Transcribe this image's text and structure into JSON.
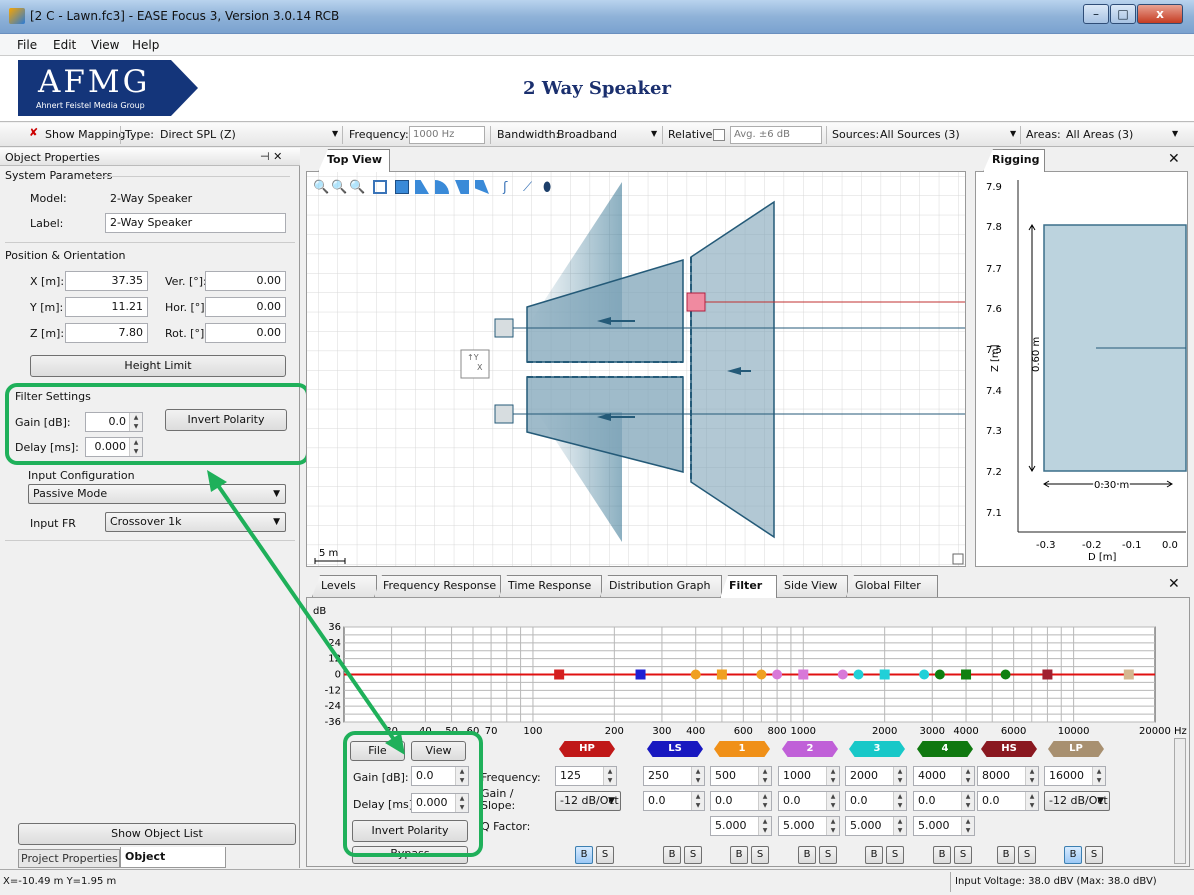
{
  "window": {
    "title": "[2 C - Lawn.fc3] - EASE Focus 3, Version 3.0.14 RCB",
    "min": "–",
    "max": "□",
    "close": "x"
  },
  "menu": [
    "File",
    "Edit",
    "View",
    "Help"
  ],
  "banner": {
    "logo_text": "AFMG",
    "logo_sub": "Ahnert Feistel Media Group",
    "title": "2 Way Speaker"
  },
  "toolbar": {
    "show_mapping": "Show Mapping",
    "type_label": "Type:",
    "type_value": "Direct SPL (Z)",
    "frequency_label": "Frequency:",
    "frequency_value": "1000 Hz",
    "bandwidth_label": "Bandwidth:",
    "bandwidth_value": "Broadband",
    "relative_label": "Relative:",
    "relative_value": "Avg. ±6 dB",
    "sources_label": "Sources:",
    "sources_value": "All Sources (3)",
    "areas_label": "Areas:",
    "areas_value": "All Areas (3)"
  },
  "left": {
    "title": "Object Properties",
    "pin": "⊣ ✕",
    "system_parameters": "System Parameters",
    "model_label": "Model:",
    "model_value": "2-Way Speaker",
    "label_label": "Label:",
    "label_value": "2-Way Speaker",
    "position_orientation": "Position & Orientation",
    "x_label": "X [m]:",
    "x_value": "37.35",
    "y_label": "Y [m]:",
    "y_value": "11.21",
    "z_label": "Z [m]:",
    "z_value": "7.80",
    "ver_label": "Ver. [°]:",
    "ver_value": "0.00",
    "hor_label": "Hor. [°]:",
    "hor_value": "0.00",
    "rot_label": "Rot. [°]:",
    "rot_value": "0.00",
    "height_limit": "Height Limit",
    "filter_settings": "Filter Settings",
    "gain_label": "Gain [dB]:",
    "gain_value": "0.0",
    "delay_label": "Delay [ms]:",
    "delay_value": "0.000",
    "invert_polarity": "Invert Polarity",
    "input_configuration": "Input Configuration",
    "input_mode": "Passive Mode",
    "input_fr_label": "Input FR",
    "input_fr_value": "Crossover 1k",
    "show_object_list": "Show Object List",
    "tab_project": "Project Properties",
    "tab_object": "Object Properties"
  },
  "topview": {
    "tab": "Top View",
    "scale": "5 m"
  },
  "rigging": {
    "tab": "Rigging",
    "close": "✕",
    "y_ticks": [
      "7.9",
      "7.8",
      "7.7",
      "7.6",
      "7.5",
      "7.4",
      "7.3",
      "7.2",
      "7.1"
    ],
    "x_ticks": [
      "-0.3",
      "-0.2",
      "-0.1",
      "0.0"
    ],
    "ylabel": "Z [m]",
    "xlabel": "D [m]",
    "height_dim": "0.60 m",
    "width_dim": "0.30 m"
  },
  "bottom": {
    "tabs": [
      "Levels",
      "Frequency Response",
      "Time Response",
      "Distribution Graph",
      "Filter",
      "Side View",
      "Global Filter"
    ],
    "close": "✕",
    "chart_data": {
      "type": "line",
      "ylabel": "dB",
      "y_ticks": [
        "36",
        "24",
        "12",
        "0",
        "-12",
        "-24",
        "-36"
      ],
      "x_ticks": [
        "30",
        "40",
        "50",
        "60",
        "70",
        "100",
        "200",
        "300",
        "400",
        "600",
        "800",
        "1000",
        "2000",
        "3000",
        "4000",
        "6000",
        "10000",
        "20000 Hz"
      ],
      "ylim": [
        -36,
        36
      ],
      "xlim": [
        20,
        20000
      ],
      "series": [
        {
          "values": [
            0,
            0
          ]
        }
      ],
      "markers": [
        {
          "freq": 125,
          "color": "#d42020",
          "shape": "square"
        },
        {
          "freq": 250,
          "color": "#2020d4",
          "shape": "square"
        },
        {
          "freq": 400,
          "color": "#f0a020",
          "shape": "circle"
        },
        {
          "freq": 500,
          "color": "#f0a020",
          "shape": "square"
        },
        {
          "freq": 700,
          "color": "#f0a020",
          "shape": "circle"
        },
        {
          "freq": 800,
          "color": "#d878d8",
          "shape": "circle"
        },
        {
          "freq": 1000,
          "color": "#d878d8",
          "shape": "square"
        },
        {
          "freq": 1400,
          "color": "#d878d8",
          "shape": "circle"
        },
        {
          "freq": 1600,
          "color": "#20d0d8",
          "shape": "circle"
        },
        {
          "freq": 2000,
          "color": "#20d0d8",
          "shape": "square"
        },
        {
          "freq": 2800,
          "color": "#20d0d8",
          "shape": "circle"
        },
        {
          "freq": 3200,
          "color": "#108010",
          "shape": "circle"
        },
        {
          "freq": 4000,
          "color": "#108010",
          "shape": "square"
        },
        {
          "freq": 5600,
          "color": "#108010",
          "shape": "circle"
        },
        {
          "freq": 8000,
          "color": "#a02030",
          "shape": "square"
        },
        {
          "freq": 16000,
          "color": "#d4b890",
          "shape": "square"
        }
      ]
    },
    "file": "File",
    "view": "View",
    "gain_label": "Gain [dB]:",
    "gain_value": "0.0",
    "delay_label": "Delay [ms]:",
    "delay_value": "0.000",
    "invert_polarity": "Invert Polarity",
    "bypass": "Bypass",
    "row_frequency": "Frequency:",
    "row_gain_1": "Gain /",
    "row_gain_2": "Slope:",
    "row_q": "Q Factor:",
    "filters": [
      {
        "name": "HP",
        "color": "#c01818",
        "freq": "125",
        "slope": "-12 dB/Oct",
        "q": "",
        "b_on": true
      },
      {
        "name": "LS",
        "color": "#1818c0",
        "freq": "250",
        "slope": "0.0",
        "q": "",
        "b_on": false
      },
      {
        "name": "1",
        "color": "#f09018",
        "freq": "500",
        "slope": "0.0",
        "q": "5.000",
        "b_on": false
      },
      {
        "name": "2",
        "color": "#c060d8",
        "freq": "1000",
        "slope": "0.0",
        "q": "5.000",
        "b_on": false
      },
      {
        "name": "3",
        "color": "#18c8c8",
        "freq": "2000",
        "slope": "0.0",
        "q": "5.000",
        "b_on": false
      },
      {
        "name": "4",
        "color": "#107810",
        "freq": "4000",
        "slope": "0.0",
        "q": "5.000",
        "b_on": false
      },
      {
        "name": "HS",
        "color": "#8a1820",
        "freq": "8000",
        "slope": "0.0",
        "q": "",
        "b_on": false
      },
      {
        "name": "LP",
        "color": "#a89070",
        "freq": "16000",
        "slope": "-12 dB/Oct",
        "q": "",
        "b_on": true
      }
    ],
    "b": "B",
    "s": "S"
  },
  "status": {
    "coords": "X=-10.49 m Y=1.95 m",
    "voltage": "Input Voltage: 38.0 dBV (Max: 38.0 dBV)"
  }
}
